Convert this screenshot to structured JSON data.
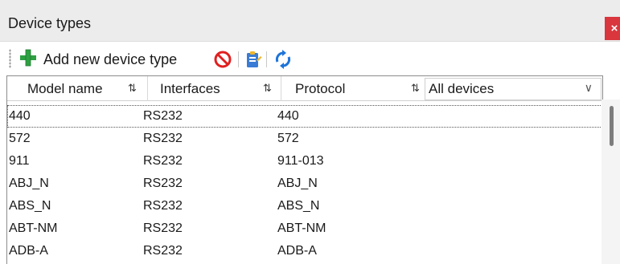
{
  "window": {
    "title": "Device types",
    "close_label": "×"
  },
  "toolbar": {
    "add_label": "Add new device type",
    "icons": [
      "plus-icon",
      "no-entry-icon",
      "clipboard-edit-icon",
      "refresh-icon"
    ]
  },
  "table": {
    "columns": [
      {
        "label": "Model name",
        "sort_icon": "⇅"
      },
      {
        "label": "Interfaces",
        "sort_icon": "⇅"
      },
      {
        "label": "Protocol",
        "sort_icon": "⇅"
      }
    ],
    "filter": {
      "selected": "All devices",
      "chevron": "∨"
    },
    "rows": [
      {
        "model": "440",
        "interface": "RS232",
        "protocol": "440"
      },
      {
        "model": "572",
        "interface": "RS232",
        "protocol": "572"
      },
      {
        "model": "911",
        "interface": "RS232",
        "protocol": "911-013"
      },
      {
        "model": "ABJ_N",
        "interface": "RS232",
        "protocol": "ABJ_N"
      },
      {
        "model": "ABS_N",
        "interface": "RS232",
        "protocol": "ABS_N"
      },
      {
        "model": "ABT-NM",
        "interface": "RS232",
        "protocol": "ABT-NM"
      },
      {
        "model": "ADB-A",
        "interface": "RS232",
        "protocol": "ADB-A"
      }
    ]
  },
  "colors": {
    "close_bg": "#d9363e",
    "add_icon": "#2ea043",
    "no_entry_icon": "#e02020",
    "refresh_icon": "#1e74d9"
  }
}
